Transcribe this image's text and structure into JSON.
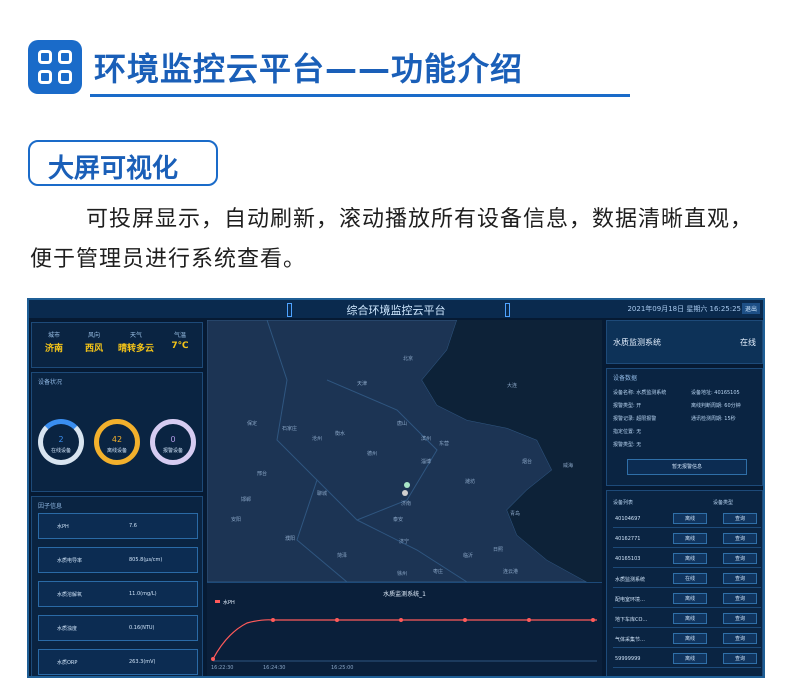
{
  "header": {
    "title": "环境监控云平台——功能介绍"
  },
  "section": {
    "title": "大屏可视化"
  },
  "description": "可投屏显示，自动刷新，滚动播放所有设备信息，数据清晰直观，便于管理员进行系统查看。",
  "dashboard": {
    "title": "综合环境监控云平台",
    "datetime": "2021年09月18日 星期六 16:25:25",
    "quit": "退出",
    "weather": [
      {
        "label": "城市",
        "value": "济南",
        "color": "#f5c518"
      },
      {
        "label": "风向",
        "value": "西风",
        "color": "#f5c518"
      },
      {
        "label": "天气",
        "value": "晴转多云",
        "color": "#f5c518"
      },
      {
        "label": "气温",
        "value": "7℃",
        "color": "#f5c518"
      }
    ],
    "device_status_title": "设备状况",
    "rings": [
      {
        "number": "2",
        "label": "在线设备",
        "color": "#3a8ef0",
        "track": "#d8e4f0"
      },
      {
        "number": "42",
        "label": "离线设备",
        "color": "#f2b02c",
        "track": "#f2b02c"
      },
      {
        "number": "0",
        "label": "报警设备",
        "color": "#b19ae6",
        "track": "#d6ccf2"
      }
    ],
    "monitor_title": "因子信息",
    "monitor_rows": [
      {
        "label": "水PH",
        "value": "7.6"
      },
      {
        "label": "水质电导率",
        "value": "805.8(μs/cm)"
      },
      {
        "label": "水质溶解氧",
        "value": "11.0(mg/L)"
      },
      {
        "label": "水质浊度",
        "value": "0.16(NTU)"
      },
      {
        "label": "水质ORP",
        "value": "263.3(mV)"
      }
    ],
    "map_labels": [
      "北京",
      "天津",
      "唐山",
      "保定",
      "沧州",
      "石家庄",
      "衡水",
      "德州",
      "邢台",
      "聊城",
      "东营",
      "滨州",
      "淄博",
      "潍坊",
      "青岛",
      "烟台",
      "大连",
      "威海",
      "临沂",
      "日照",
      "济宁",
      "泰安",
      "济南",
      "菏泽",
      "枣庄",
      "徐州",
      "连云港",
      "安阳",
      "邯郸",
      "濮阳"
    ],
    "chart": {
      "title": "水质监测系统_1",
      "legend": "水PH",
      "x_labels": [
        "16:22:30",
        "16:24:30",
        "16:25:00"
      ]
    },
    "device_info": {
      "name": "水质监测系统",
      "status": "在线",
      "section_title": "设备数据",
      "lines": [
        "设备名称: 水质监测系统",
        "设备地址: 40165105",
        "报警类型: 开",
        "离线判断周期: 60分钟",
        "报警记录: 超限报警",
        "通讯检测周期: 15秒",
        "指定位置: 无",
        "报警类型: 无"
      ],
      "button": "暂无报警信息"
    },
    "device_list": {
      "col1": "设备列表",
      "col2": "设备类型",
      "rows": [
        {
          "name": "40104697",
          "status": "离线",
          "op": "查询"
        },
        {
          "name": "40162771",
          "status": "离线",
          "op": "查询"
        },
        {
          "name": "40165103",
          "status": "离线",
          "op": "查询"
        },
        {
          "name": "水质监测系统",
          "status": "在线",
          "op": "查询"
        },
        {
          "name": "配电室环境…",
          "status": "离线",
          "op": "查询"
        },
        {
          "name": "地下车库CO…",
          "status": "离线",
          "op": "查询"
        },
        {
          "name": "气体采集节…",
          "status": "离线",
          "op": "查询"
        },
        {
          "name": "59999999",
          "status": "离线",
          "op": "查询"
        }
      ]
    }
  }
}
